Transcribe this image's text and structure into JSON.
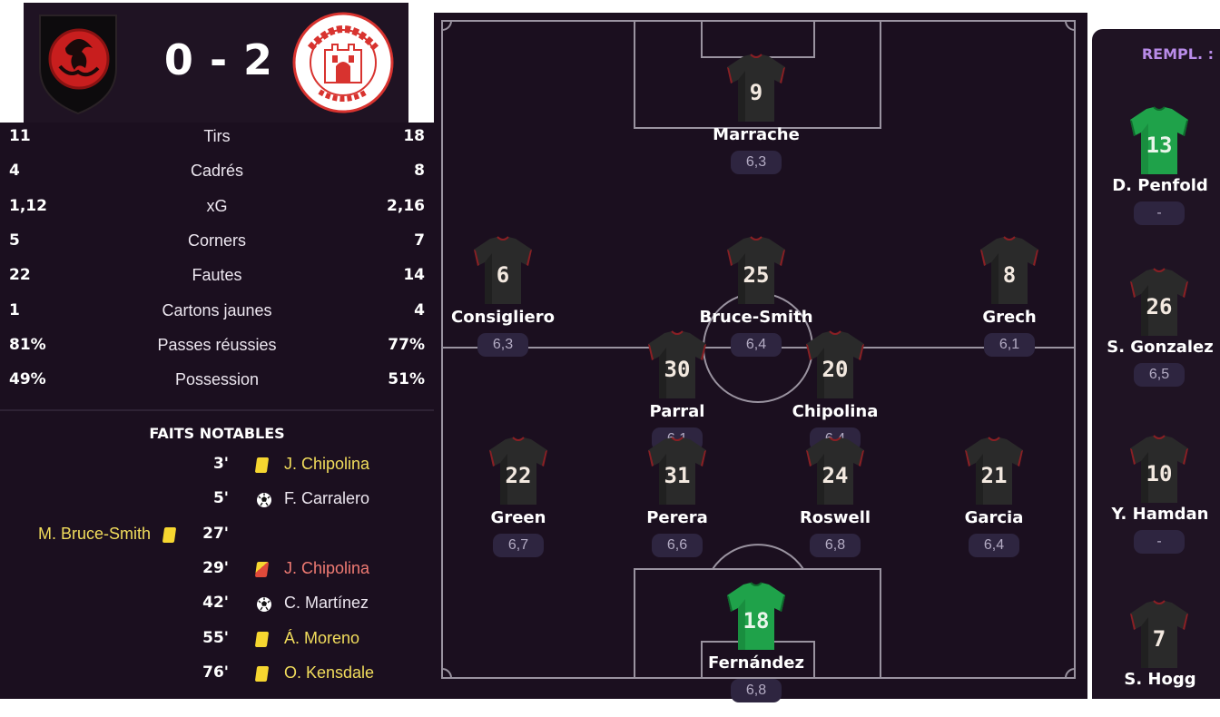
{
  "match": {
    "score": "0 - 2",
    "home_badge": "dragon-crest-icon",
    "away_badge": "lincoln-red-imps-badge",
    "away_badge_text": "LINCOLN RED IMPS GIBRALTAR"
  },
  "stats": [
    {
      "label": "Tirs",
      "home": "11",
      "away": "18"
    },
    {
      "label": "Cadrés",
      "home": "4",
      "away": "8"
    },
    {
      "label": "xG",
      "home": "1,12",
      "away": "2,16"
    },
    {
      "label": "Corners",
      "home": "5",
      "away": "7"
    },
    {
      "label": "Fautes",
      "home": "22",
      "away": "14"
    },
    {
      "label": "Cartons jaunes",
      "home": "1",
      "away": "4"
    },
    {
      "label": "Passes réussies",
      "home": "81%",
      "away": "77%"
    },
    {
      "label": "Possession",
      "home": "49%",
      "away": "51%"
    }
  ],
  "events": {
    "title": "FAITS NOTABLES",
    "items": [
      {
        "minute": "3'",
        "side": "away",
        "type": "yellow-card-icon",
        "player": "J. Chipolina"
      },
      {
        "minute": "5'",
        "side": "away",
        "type": "goal-ball-icon",
        "player": "F. Carralero"
      },
      {
        "minute": "27'",
        "side": "home",
        "type": "yellow-card-icon",
        "player": "M. Bruce-Smith"
      },
      {
        "minute": "29'",
        "side": "away",
        "type": "second-yellow-red-card-icon",
        "player": "J. Chipolina"
      },
      {
        "minute": "42'",
        "side": "away",
        "type": "goal-ball-icon",
        "player": "C. Martínez"
      },
      {
        "minute": "55'",
        "side": "away",
        "type": "yellow-card-icon",
        "player": "Á. Moreno"
      },
      {
        "minute": "76'",
        "side": "away",
        "type": "yellow-card-icon",
        "player": "O. Kensdale"
      }
    ]
  },
  "lineup": [
    {
      "number": "9",
      "name": "Marrache",
      "rating": "6,3",
      "kit": "outfield"
    },
    {
      "number": "6",
      "name": "Consigliero",
      "rating": "6,3",
      "kit": "outfield"
    },
    {
      "number": "25",
      "name": "Bruce-Smith",
      "rating": "6,4",
      "kit": "outfield"
    },
    {
      "number": "8",
      "name": "Grech",
      "rating": "6,1",
      "kit": "outfield"
    },
    {
      "number": "30",
      "name": "Parral",
      "rating": "6,1",
      "kit": "outfield"
    },
    {
      "number": "20",
      "name": "Chipolina",
      "rating": "6,4",
      "kit": "outfield"
    },
    {
      "number": "22",
      "name": "Green",
      "rating": "6,7",
      "kit": "outfield"
    },
    {
      "number": "31",
      "name": "Perera",
      "rating": "6,6",
      "kit": "outfield"
    },
    {
      "number": "24",
      "name": "Roswell",
      "rating": "6,8",
      "kit": "outfield"
    },
    {
      "number": "21",
      "name": "Garcia",
      "rating": "6,4",
      "kit": "outfield"
    },
    {
      "number": "18",
      "name": "Fernández",
      "rating": "6,8",
      "kit": "goalkeeper"
    }
  ],
  "substitutes": {
    "title": "REMPL. :",
    "players": [
      {
        "number": "13",
        "name": "D. Penfold",
        "rating": "-",
        "kit": "goalkeeper"
      },
      {
        "number": "26",
        "name": "S. Gonzalez",
        "rating": "6,5",
        "kit": "outfield"
      },
      {
        "number": "10",
        "name": "Y. Hamdan",
        "rating": "-",
        "kit": "outfield"
      },
      {
        "number": "7",
        "name": "S. Hogg",
        "rating": "",
        "kit": "outfield"
      }
    ]
  },
  "colors": {
    "panel_bg": "#1b0f1f",
    "rating_pill": "#2e2540",
    "yellow_text": "#f2dd5c",
    "red_text": "#f07b73",
    "subs_title": "#b88be8",
    "outfield_kit": "#2a2a2a",
    "goalkeeper_kit": "#1fa24a"
  }
}
